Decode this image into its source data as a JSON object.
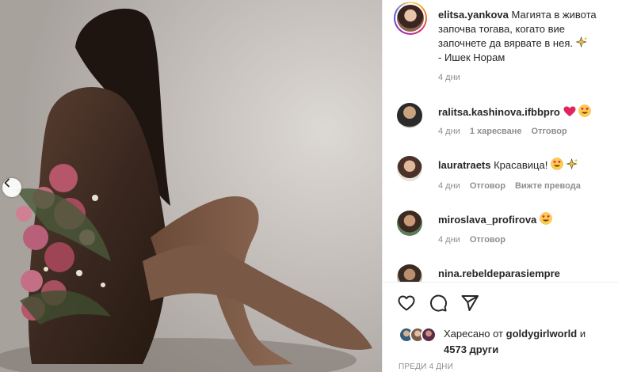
{
  "post": {
    "author": "elitsa.yankova",
    "caption": "Магията в живота започва тогава, когато вие започнете да вярвате в нея.",
    "caption_line3_suffix": "- Ишек Норам",
    "time": "4 дни"
  },
  "comments": [
    {
      "user": "ralitsa.kashinova.ifbbpro",
      "text": "",
      "time": "4 дни",
      "likes": "1 харесване",
      "reply": "Отговор",
      "emojis": [
        "heart",
        "face-hearts"
      ]
    },
    {
      "user": "lauratraets",
      "text": "Красавица!",
      "time": "4 дни",
      "reply": "Отговор",
      "translate": "Вижте превода",
      "emojis": [
        "face-hearts",
        "sparkles"
      ]
    },
    {
      "user": "miroslava_profirova",
      "text": "",
      "time": "4 дни",
      "reply": "Отговор",
      "emojis": [
        "face-hearts"
      ]
    },
    {
      "user": "nina.rebeldeparasiempre",
      "text": ""
    }
  ],
  "likes": {
    "prefix": "Харесано от",
    "liker": "goldygirlworld",
    "and": "и",
    "others": "4573 други"
  },
  "timestamp": "ПРЕДИ 4 ДНИ",
  "icons": {
    "like": "heart-outline-icon",
    "comment": "comment-bubble-icon",
    "share": "paper-plane-icon",
    "prev": "chevron-left-icon"
  }
}
